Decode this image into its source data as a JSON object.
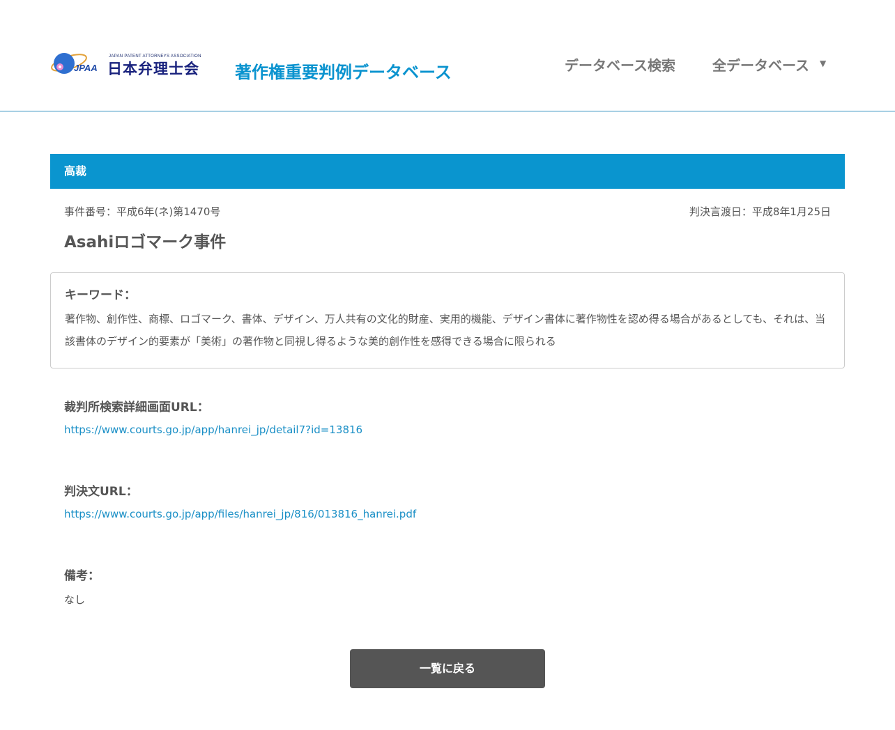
{
  "header": {
    "logo": {
      "subtitle": "JAPAN PATENT ATTORNEYS ASSOCIATION",
      "mark_text": "JPAA",
      "org_name": "日本弁理士会",
      "globe_color": "#2f6fd0",
      "ring_color": "#e3a23a"
    },
    "site_title": "著作権重要判例データベース",
    "nav": {
      "search_label": "データベース検索",
      "all_label": "全データベース",
      "caret": "▼"
    }
  },
  "case": {
    "court": "高裁",
    "case_number": "事件番号：平成6年(ネ)第1470号",
    "judgment_date": "判決言渡日：平成8年1月25日",
    "title": "Asahiロゴマーク事件",
    "keywords": {
      "label": "キーワード：",
      "text": "著作物、創作性、商標、ロゴマーク、書体、デザイン、万人共有の文化的財産、実用的機能、デザイン書体に著作物性を認め得る場合があるとしても、それは、当該書体のデザイン的要素が「美術」の著作物と同視し得るような美的創作性を感得できる場合に限られる"
    },
    "court_url": {
      "label": "裁判所検索詳細画面URL：",
      "url": "https://www.courts.go.jp/app/hanrei_jp/detail7?id=13816"
    },
    "judgment_url": {
      "label": "判決文URL：",
      "url": "https://www.courts.go.jp/app/files/hanrei_jp/816/013816_hanrei.pdf"
    },
    "remarks": {
      "label": "備考：",
      "text": "なし"
    }
  },
  "back_button": "一覧に戻る",
  "colors": {
    "accent": "#0a95cf",
    "link": "#1a8fc6",
    "button": "#555555",
    "text": "#555555"
  }
}
